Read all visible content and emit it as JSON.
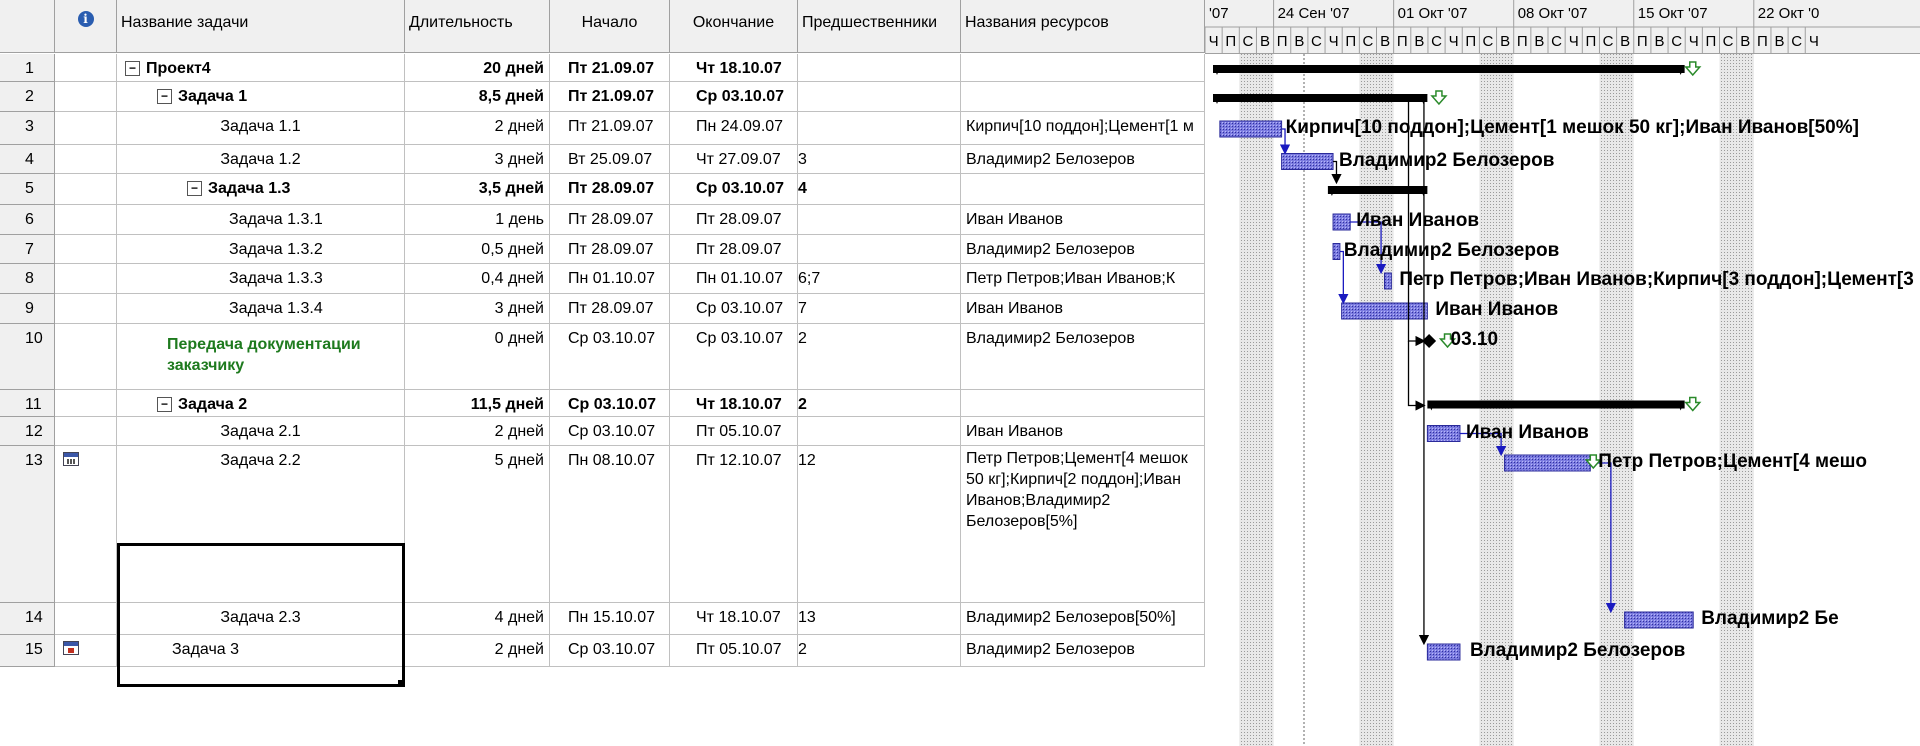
{
  "columns": {
    "info_icon": "info-icon",
    "name": "Название задачи",
    "duration": "Длительность",
    "start": "Начало",
    "finish": "Окончание",
    "predecessors": "Предшественники",
    "resources": "Названия ресурсов"
  },
  "rows": [
    {
      "id": "1",
      "name": "Проект4",
      "duration": "20 дней",
      "start": "Пт 21.09.07",
      "finish": "Чт 18.10.07",
      "pred": "",
      "res": ""
    },
    {
      "id": "2",
      "name": "Задача 1",
      "duration": "8,5 дней",
      "start": "Пт 21.09.07",
      "finish": "Ср 03.10.07",
      "pred": "",
      "res": ""
    },
    {
      "id": "3",
      "name": "Задача 1.1",
      "duration": "2 дней",
      "start": "Пт 21.09.07",
      "finish": "Пн 24.09.07",
      "pred": "",
      "res": "Кирпич[10 поддон];Цемент[1 м"
    },
    {
      "id": "4",
      "name": "Задача 1.2",
      "duration": "3 дней",
      "start": "Вт 25.09.07",
      "finish": "Чт 27.09.07",
      "pred": "3",
      "res": "Владимир2 Белозеров"
    },
    {
      "id": "5",
      "name": "Задача 1.3",
      "duration": "3,5 дней",
      "start": "Пт 28.09.07",
      "finish": "Ср 03.10.07",
      "pred": "4",
      "res": ""
    },
    {
      "id": "6",
      "name": "Задача 1.3.1",
      "duration": "1 день",
      "start": "Пт 28.09.07",
      "finish": "Пт 28.09.07",
      "pred": "",
      "res": "Иван Иванов"
    },
    {
      "id": "7",
      "name": "Задача 1.3.2",
      "duration": "0,5 дней",
      "start": "Пт 28.09.07",
      "finish": "Пт 28.09.07",
      "pred": "",
      "res": "Владимир2 Белозеров"
    },
    {
      "id": "8",
      "name": "Задача 1.3.3",
      "duration": "0,4 дней",
      "start": "Пн 01.10.07",
      "finish": "Пн 01.10.07",
      "pred": "6;7",
      "res": "Петр Петров;Иван Иванов;К"
    },
    {
      "id": "9",
      "name": "Задача 1.3.4",
      "duration": "3 дней",
      "start": "Пт 28.09.07",
      "finish": "Ср 03.10.07",
      "pred": "7",
      "res": "Иван Иванов"
    },
    {
      "id": "10",
      "name": "Передача документации заказчику",
      "duration": "0 дней",
      "start": "Ср 03.10.07",
      "finish": "Ср 03.10.07",
      "pred": "2",
      "res": "Владимир2 Белозеров"
    },
    {
      "id": "11",
      "name": "Задача 2",
      "duration": "11,5 дней",
      "start": "Ср 03.10.07",
      "finish": "Чт 18.10.07",
      "pred": "2",
      "res": ""
    },
    {
      "id": "12",
      "name": "Задача 2.1",
      "duration": "2 дней",
      "start": "Ср 03.10.07",
      "finish": "Пт 05.10.07",
      "pred": "",
      "res": "Иван Иванов"
    },
    {
      "id": "13",
      "name": "Задача 2.2",
      "duration": "5 дней",
      "start": "Пн 08.10.07",
      "finish": "Пт 12.10.07",
      "pred": "12",
      "res": "Петр Петров;Цемент[4 мешок 50 кг];Кирпич[2 поддон];Иван Иванов;Владимир2 Белозеров[5%]"
    },
    {
      "id": "14",
      "name": "Задача 2.3",
      "duration": "4 дней",
      "start": "Пн 15.10.07",
      "finish": "Чт 18.10.07",
      "pred": "13",
      "res": "Владимир2 Белозеров[50%]"
    },
    {
      "id": "15",
      "name": "Задача 3",
      "duration": "2 дней",
      "start": "Ср 03.10.07",
      "finish": "Пт 05.10.07",
      "pred": "2",
      "res": "Владимир2 Белозеров"
    }
  ],
  "indicator_icons": [
    "calendar-icon",
    "calendar-icon"
  ],
  "timescale": {
    "weeks": [
      "'07",
      "24 Сен '07",
      "01 Окт '07",
      "08 Окт '07",
      "15 Окт '07",
      "22 Окт '0"
    ],
    "days": [
      "Ч",
      "П",
      "С",
      "В",
      "П",
      "В",
      "С",
      "Ч",
      "П",
      "С",
      "В",
      "П",
      "В",
      "С",
      "Ч",
      "П",
      "С",
      "В",
      "П",
      "В",
      "С",
      "Ч",
      "П",
      "С",
      "В",
      "П",
      "В",
      "С",
      "Ч",
      "П",
      "С",
      "В",
      "П",
      "В",
      "С",
      "Ч"
    ]
  },
  "gantt_labels": {
    "r3": "Кирпич[10 поддон];Цемент[1 мешок 50 кг];Иван Иванов[50%]",
    "r4": "Владимир2 Белозеров",
    "r6": "Иван Иванов",
    "r7": "Владимир2 Белозеров",
    "r8": "Петр Петров;Иван Иванов;Кирпич[3 поддон];Цемент[3 м",
    "r9": "Иван Иванов",
    "r10": "03.10",
    "r12": "Иван Иванов",
    "r13": "Петр Петров;Цемент[4 мешо",
    "r14": "Владимир2 Бе",
    "r15": "Владимир2 Белозеров"
  },
  "colors": {
    "bar_fill": "#6f6fd8",
    "link": "#1a1ac0",
    "summary": "#000000",
    "milestone_text": "#1e7a1e"
  }
}
